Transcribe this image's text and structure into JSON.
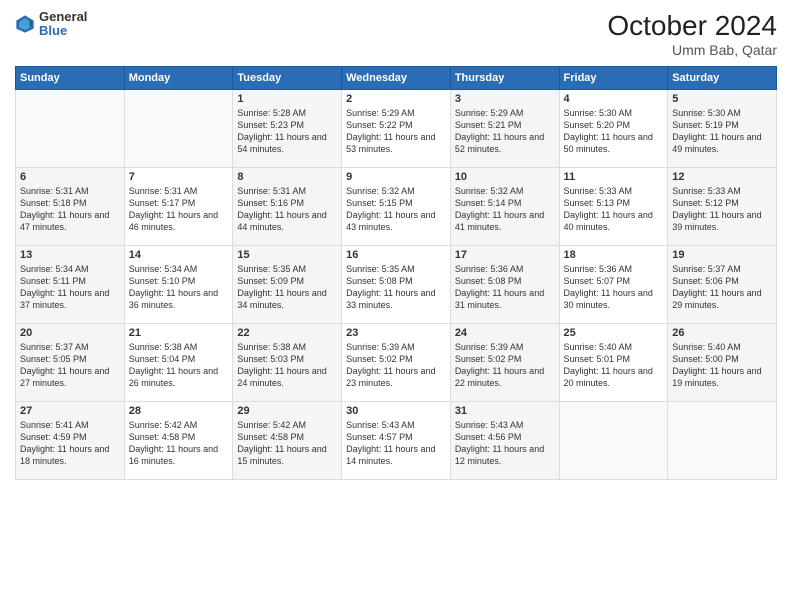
{
  "header": {
    "logo_general": "General",
    "logo_blue": "Blue",
    "month_title": "October 2024",
    "location": "Umm Bab, Qatar"
  },
  "weekdays": [
    "Sunday",
    "Monday",
    "Tuesday",
    "Wednesday",
    "Thursday",
    "Friday",
    "Saturday"
  ],
  "weeks": [
    [
      {
        "date": "",
        "sunrise": "",
        "sunset": "",
        "daylight": ""
      },
      {
        "date": "",
        "sunrise": "",
        "sunset": "",
        "daylight": ""
      },
      {
        "date": "1",
        "sunrise": "Sunrise: 5:28 AM",
        "sunset": "Sunset: 5:23 PM",
        "daylight": "Daylight: 11 hours and 54 minutes."
      },
      {
        "date": "2",
        "sunrise": "Sunrise: 5:29 AM",
        "sunset": "Sunset: 5:22 PM",
        "daylight": "Daylight: 11 hours and 53 minutes."
      },
      {
        "date": "3",
        "sunrise": "Sunrise: 5:29 AM",
        "sunset": "Sunset: 5:21 PM",
        "daylight": "Daylight: 11 hours and 52 minutes."
      },
      {
        "date": "4",
        "sunrise": "Sunrise: 5:30 AM",
        "sunset": "Sunset: 5:20 PM",
        "daylight": "Daylight: 11 hours and 50 minutes."
      },
      {
        "date": "5",
        "sunrise": "Sunrise: 5:30 AM",
        "sunset": "Sunset: 5:19 PM",
        "daylight": "Daylight: 11 hours and 49 minutes."
      }
    ],
    [
      {
        "date": "6",
        "sunrise": "Sunrise: 5:31 AM",
        "sunset": "Sunset: 5:18 PM",
        "daylight": "Daylight: 11 hours and 47 minutes."
      },
      {
        "date": "7",
        "sunrise": "Sunrise: 5:31 AM",
        "sunset": "Sunset: 5:17 PM",
        "daylight": "Daylight: 11 hours and 46 minutes."
      },
      {
        "date": "8",
        "sunrise": "Sunrise: 5:31 AM",
        "sunset": "Sunset: 5:16 PM",
        "daylight": "Daylight: 11 hours and 44 minutes."
      },
      {
        "date": "9",
        "sunrise": "Sunrise: 5:32 AM",
        "sunset": "Sunset: 5:15 PM",
        "daylight": "Daylight: 11 hours and 43 minutes."
      },
      {
        "date": "10",
        "sunrise": "Sunrise: 5:32 AM",
        "sunset": "Sunset: 5:14 PM",
        "daylight": "Daylight: 11 hours and 41 minutes."
      },
      {
        "date": "11",
        "sunrise": "Sunrise: 5:33 AM",
        "sunset": "Sunset: 5:13 PM",
        "daylight": "Daylight: 11 hours and 40 minutes."
      },
      {
        "date": "12",
        "sunrise": "Sunrise: 5:33 AM",
        "sunset": "Sunset: 5:12 PM",
        "daylight": "Daylight: 11 hours and 39 minutes."
      }
    ],
    [
      {
        "date": "13",
        "sunrise": "Sunrise: 5:34 AM",
        "sunset": "Sunset: 5:11 PM",
        "daylight": "Daylight: 11 hours and 37 minutes."
      },
      {
        "date": "14",
        "sunrise": "Sunrise: 5:34 AM",
        "sunset": "Sunset: 5:10 PM",
        "daylight": "Daylight: 11 hours and 36 minutes."
      },
      {
        "date": "15",
        "sunrise": "Sunrise: 5:35 AM",
        "sunset": "Sunset: 5:09 PM",
        "daylight": "Daylight: 11 hours and 34 minutes."
      },
      {
        "date": "16",
        "sunrise": "Sunrise: 5:35 AM",
        "sunset": "Sunset: 5:08 PM",
        "daylight": "Daylight: 11 hours and 33 minutes."
      },
      {
        "date": "17",
        "sunrise": "Sunrise: 5:36 AM",
        "sunset": "Sunset: 5:08 PM",
        "daylight": "Daylight: 11 hours and 31 minutes."
      },
      {
        "date": "18",
        "sunrise": "Sunrise: 5:36 AM",
        "sunset": "Sunset: 5:07 PM",
        "daylight": "Daylight: 11 hours and 30 minutes."
      },
      {
        "date": "19",
        "sunrise": "Sunrise: 5:37 AM",
        "sunset": "Sunset: 5:06 PM",
        "daylight": "Daylight: 11 hours and 29 minutes."
      }
    ],
    [
      {
        "date": "20",
        "sunrise": "Sunrise: 5:37 AM",
        "sunset": "Sunset: 5:05 PM",
        "daylight": "Daylight: 11 hours and 27 minutes."
      },
      {
        "date": "21",
        "sunrise": "Sunrise: 5:38 AM",
        "sunset": "Sunset: 5:04 PM",
        "daylight": "Daylight: 11 hours and 26 minutes."
      },
      {
        "date": "22",
        "sunrise": "Sunrise: 5:38 AM",
        "sunset": "Sunset: 5:03 PM",
        "daylight": "Daylight: 11 hours and 24 minutes."
      },
      {
        "date": "23",
        "sunrise": "Sunrise: 5:39 AM",
        "sunset": "Sunset: 5:02 PM",
        "daylight": "Daylight: 11 hours and 23 minutes."
      },
      {
        "date": "24",
        "sunrise": "Sunrise: 5:39 AM",
        "sunset": "Sunset: 5:02 PM",
        "daylight": "Daylight: 11 hours and 22 minutes."
      },
      {
        "date": "25",
        "sunrise": "Sunrise: 5:40 AM",
        "sunset": "Sunset: 5:01 PM",
        "daylight": "Daylight: 11 hours and 20 minutes."
      },
      {
        "date": "26",
        "sunrise": "Sunrise: 5:40 AM",
        "sunset": "Sunset: 5:00 PM",
        "daylight": "Daylight: 11 hours and 19 minutes."
      }
    ],
    [
      {
        "date": "27",
        "sunrise": "Sunrise: 5:41 AM",
        "sunset": "Sunset: 4:59 PM",
        "daylight": "Daylight: 11 hours and 18 minutes."
      },
      {
        "date": "28",
        "sunrise": "Sunrise: 5:42 AM",
        "sunset": "Sunset: 4:58 PM",
        "daylight": "Daylight: 11 hours and 16 minutes."
      },
      {
        "date": "29",
        "sunrise": "Sunrise: 5:42 AM",
        "sunset": "Sunset: 4:58 PM",
        "daylight": "Daylight: 11 hours and 15 minutes."
      },
      {
        "date": "30",
        "sunrise": "Sunrise: 5:43 AM",
        "sunset": "Sunset: 4:57 PM",
        "daylight": "Daylight: 11 hours and 14 minutes."
      },
      {
        "date": "31",
        "sunrise": "Sunrise: 5:43 AM",
        "sunset": "Sunset: 4:56 PM",
        "daylight": "Daylight: 11 hours and 12 minutes."
      },
      {
        "date": "",
        "sunrise": "",
        "sunset": "",
        "daylight": ""
      },
      {
        "date": "",
        "sunrise": "",
        "sunset": "",
        "daylight": ""
      }
    ]
  ]
}
